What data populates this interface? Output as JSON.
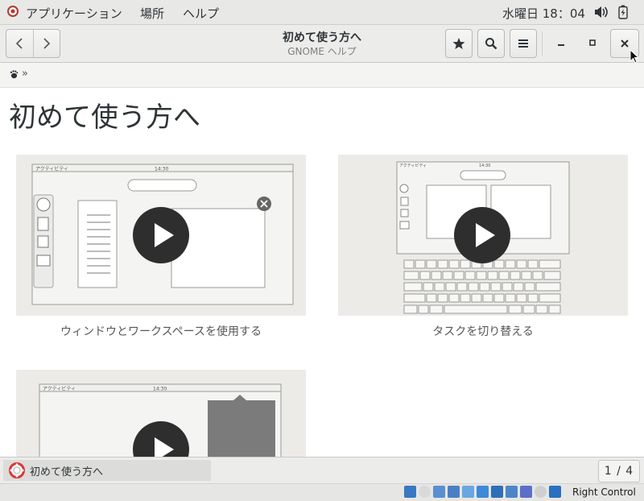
{
  "topbar": {
    "menus": [
      "アプリケーション",
      "場所",
      "ヘルプ"
    ],
    "clock": "水曜日 18：04"
  },
  "headerbar": {
    "title": "初めて使う方へ",
    "subtitle": "GNOME ヘルプ",
    "buttons": [
      "back-icon",
      "forward-icon",
      "bookmark-star-icon",
      "search-icon",
      "menu-icon",
      "minimize-icon",
      "maximize-icon",
      "close-icon"
    ]
  },
  "trail": {
    "separator": "»"
  },
  "page": {
    "heading": "初めて使う方へ",
    "cards": [
      {
        "caption": "ウィンドウとワークスペースを使用する",
        "mock_activities": "アクティビティ",
        "mock_clock": "14:30"
      },
      {
        "caption": "タスクを切り替える",
        "mock_activities": "アクティビティ",
        "mock_clock": "14:30"
      },
      {
        "caption": "",
        "mock_activities": "アクティビティ",
        "mock_clock": "14:30"
      }
    ]
  },
  "statusbar": {
    "task_label": "初めて使う方へ",
    "pager": "1 / 4"
  },
  "vbox": {
    "host_key": "Right Control"
  },
  "colors": {
    "accent": "#2e2e2e",
    "card_bg": "#ecebe8",
    "bar_bg": "#ececeb"
  }
}
